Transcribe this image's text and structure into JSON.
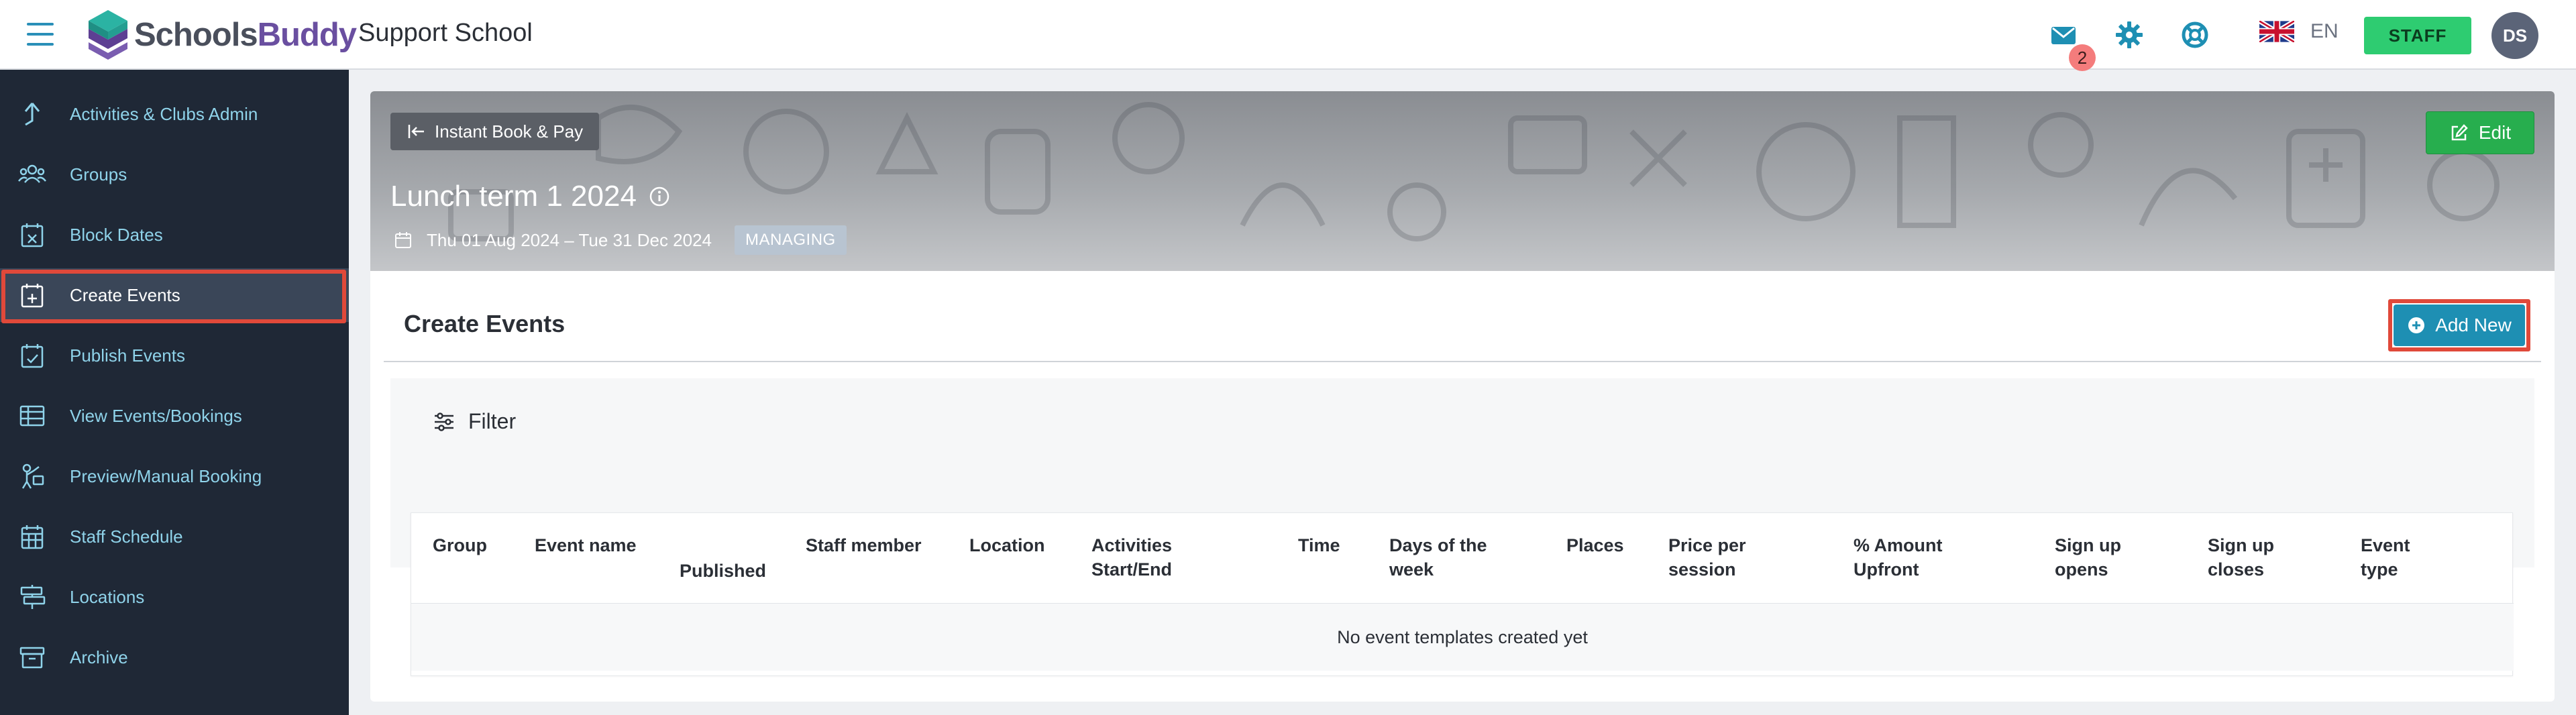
{
  "header": {
    "logo_part1": "Schools",
    "logo_part2": "Buddy",
    "school_name": "Support School",
    "mail_count": "2",
    "language": "EN",
    "role_button": "STAFF",
    "avatar_initials": "DS",
    "icon_color": "#1e8fb3"
  },
  "sidebar": {
    "items": [
      {
        "label": "Activities & Clubs Admin",
        "icon": "arrow-up-icon"
      },
      {
        "label": "Groups",
        "icon": "users-icon"
      },
      {
        "label": "Block Dates",
        "icon": "calendar-x-icon"
      },
      {
        "label": "Create Events",
        "icon": "calendar-plus-icon",
        "active": true
      },
      {
        "label": "Publish Events",
        "icon": "calendar-check-icon"
      },
      {
        "label": "View Events/Bookings",
        "icon": "table-icon"
      },
      {
        "label": "Preview/Manual Booking",
        "icon": "person-pointer-icon"
      },
      {
        "label": "Staff Schedule",
        "icon": "calendar-grid-icon"
      },
      {
        "label": "Locations",
        "icon": "signpost-icon"
      },
      {
        "label": "Archive",
        "icon": "archive-icon"
      }
    ]
  },
  "hero": {
    "back_label": "Instant Book & Pay",
    "edit_label": "Edit",
    "title": "Lunch term 1 2024",
    "dates": "Thu 01 Aug 2024 – Tue 31 Dec 2024",
    "status_badge": "MANAGING"
  },
  "content": {
    "section_title": "Create Events",
    "add_new_label": "Add New",
    "filter_label": "Filter",
    "columns": {
      "group": "Group",
      "event_name": "Event name",
      "published": "Published",
      "staff_member": "Staff member",
      "location": "Location",
      "activities_1": "Activities",
      "activities_2": "Start/End",
      "time": "Time",
      "days_1": "Days of the",
      "days_2": "week",
      "places": "Places",
      "price_1": "Price per",
      "price_2": "session",
      "amount_1": "% Amount",
      "amount_2": "Upfront",
      "opens_1": "Sign up",
      "opens_2": "opens",
      "closes_1": "Sign up",
      "closes_2": "closes",
      "type_1": "Event",
      "type_2": "type"
    },
    "empty_message": "No event templates created yet"
  }
}
